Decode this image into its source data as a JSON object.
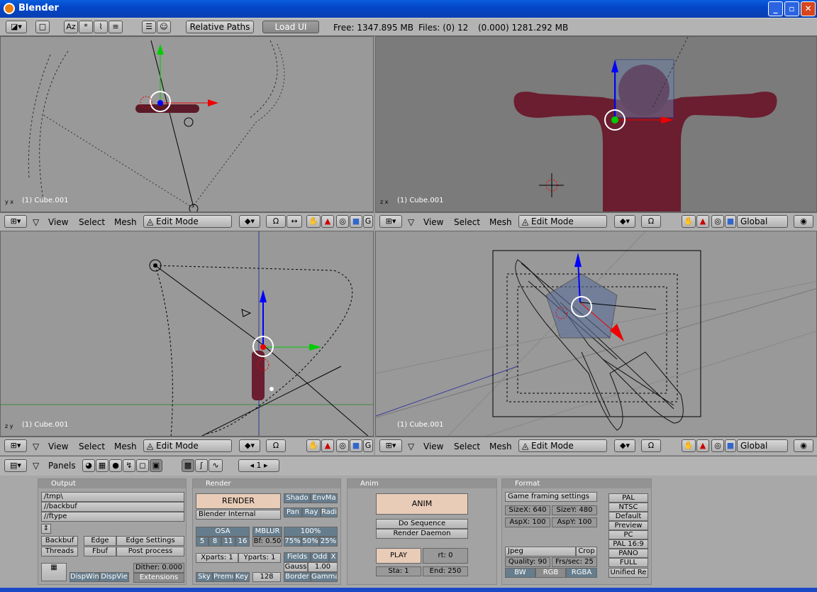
{
  "window": {
    "title": "Blender"
  },
  "topbar": {
    "relative_paths": "Relative Paths",
    "load_ui": "Load UI",
    "free": "Free: 1347.895 MB",
    "files": "Files: (0) 12",
    "mem": "(0.000) 1281.292 MB"
  },
  "viewports": {
    "label": "(1) Cube.001",
    "header": {
      "view": "View",
      "select": "Select",
      "mesh": "Mesh",
      "mode": "Edit Mode",
      "orient": "Global",
      "clipped": "G"
    }
  },
  "buttons_window": {
    "panels_label": "Panels",
    "frame": "1",
    "output": {
      "title": "Output",
      "path1": "/tmp\\",
      "path2": "//backbuf",
      "path3": "//ftype",
      "backbuf": "Backbuf",
      "edge": "Edge",
      "edge_settings": "Edge Settings",
      "threads": "Threads",
      "fbuf": "Fbuf",
      "post_process": "Post process",
      "dither": "Dither: 0.000",
      "dispwin": "DispWin",
      "dispview": "DispVie",
      "extensions": "Extensions"
    },
    "render": {
      "title": "Render",
      "render": "RENDER",
      "shadow": "Shado",
      "envmap": "EnvMa",
      "engine": "Blender Internal",
      "pano": "Pan",
      "ray": "Ray",
      "radio": "Radi",
      "osa": "OSA",
      "mblur": "MBLUR",
      "pct100": "100%",
      "osa5": "5",
      "osa8": "8",
      "osa11": "11",
      "osa16": "16",
      "bf": "Bf: 0.50",
      "pct75": "75%",
      "pct50": "50%",
      "pct25": "25%",
      "xparts": "Xparts: 1",
      "yparts": "Yparts: 1",
      "fields": "Fields",
      "odd": "Odd",
      "x": "X",
      "gauss": "Gauss",
      "gauss_val": "1.00",
      "sky": "Sky",
      "premul": "Premu",
      "key": "Key",
      "size128": "128",
      "border": "Border",
      "gamma": "Gamma"
    },
    "anim": {
      "title": "Anim",
      "anim": "ANIM",
      "do_sequence": "Do Sequence",
      "render_daemon": "Render Daemon",
      "play": "PLAY",
      "rt": "rt: 0",
      "sta": "Sta: 1",
      "end": "End: 250"
    },
    "format": {
      "title": "Format",
      "game_framing": "Game framing settings",
      "sizex": "SizeX: 640",
      "sizey": "SizeY: 480",
      "aspx": "AspX: 100",
      "aspy": "AspY: 100",
      "jpeg": "Jpeg",
      "crop": "Crop",
      "quality": "Quality: 90",
      "frs": "Frs/sec: 25",
      "bw": "BW",
      "rgb": "RGB",
      "rgba": "RGBA",
      "pal": "PAL",
      "ntsc": "NTSC",
      "default": "Default",
      "preview": "Preview",
      "pc": "PC",
      "pal169": "PAL 16:9",
      "pano": "PANO",
      "full": "FULL",
      "unified": "Unified Re"
    }
  }
}
